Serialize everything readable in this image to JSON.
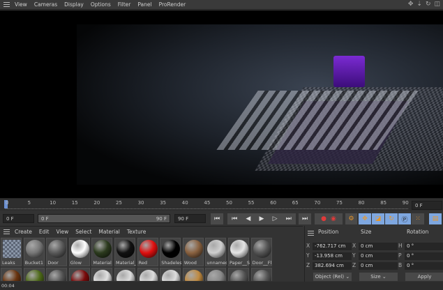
{
  "viewport_menu": [
    "View",
    "Cameras",
    "Display",
    "Options",
    "Filter",
    "Panel",
    "ProRender"
  ],
  "nav_icons": [
    "move-view-icon",
    "dolly-icon",
    "rotate-view-icon",
    "maximize-icon"
  ],
  "timeline": {
    "ticks": [
      "0",
      "5",
      "10",
      "15",
      "20",
      "25",
      "30",
      "35",
      "40",
      "45",
      "50",
      "55",
      "60",
      "65",
      "70",
      "75",
      "80",
      "85",
      "90"
    ],
    "current_frame": "0 F",
    "start": "0 F",
    "range_start": "0 F",
    "range_end": "90 F",
    "end": "90 F"
  },
  "material_menu": [
    "Create",
    "Edit",
    "View",
    "Select",
    "Material",
    "Texture"
  ],
  "materials": [
    {
      "name": "Leaks",
      "color": "checker"
    },
    {
      "name": "Bucket1",
      "color": "#777"
    },
    {
      "name": "Door",
      "color": "#5a5a5a"
    },
    {
      "name": "Glow",
      "color": "#fff"
    },
    {
      "name": "Material",
      "color": "#2c3b1e"
    },
    {
      "name": "Material_",
      "color": "#111"
    },
    {
      "name": "Red",
      "color": "#e01010"
    },
    {
      "name": "Shadeless",
      "color": "#000"
    },
    {
      "name": "Wood",
      "color": "#8a6240"
    },
    {
      "name": "unnamed",
      "color": "#cfcfcf"
    },
    {
      "name": "Paper__S",
      "color": "#e4e4e4"
    },
    {
      "name": "Door__Fl",
      "color": "#555"
    }
  ],
  "materials_row2": [
    "#6a3510",
    "#4e6a18",
    "#555",
    "#7a0a0a",
    "#e0e0e0",
    "#ddd",
    "#ddd",
    "#ddd",
    "#c08a40",
    "#888",
    "#555",
    "#555"
  ],
  "coords": {
    "headers": [
      "Position",
      "Size",
      "Rotation"
    ],
    "position": [
      {
        "axis": "X",
        "value": "-762.717 cm"
      },
      {
        "axis": "Y",
        "value": "-13.958 cm"
      },
      {
        "axis": "Z",
        "value": "382.694 cm"
      }
    ],
    "size": [
      {
        "axis": "X",
        "value": "0 cm"
      },
      {
        "axis": "Y",
        "value": "0 cm"
      },
      {
        "axis": "Z",
        "value": "0 cm"
      }
    ],
    "rotation": [
      {
        "axis": "H",
        "value": "0 °"
      },
      {
        "axis": "P",
        "value": "0 °"
      },
      {
        "axis": "B",
        "value": "0 °"
      }
    ],
    "mode": "Object (Rel)",
    "size_mode": "Size",
    "apply": "Apply"
  },
  "status": "00:04"
}
